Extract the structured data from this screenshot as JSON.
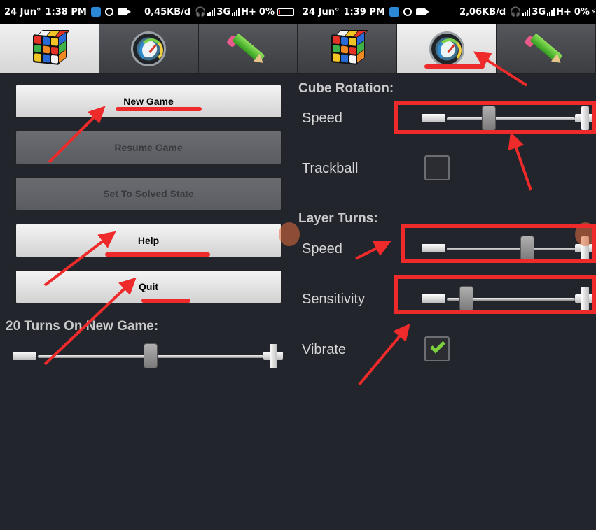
{
  "status_left": {
    "date": "24 Jun°",
    "time": "1:38 PM",
    "network": "0,45KB/d",
    "net_type": "3G",
    "signal2": "H+",
    "battery": "0%"
  },
  "status_right": {
    "date": "24 Jun°",
    "time": "1:39 PM",
    "network": "2,06KB/d",
    "net_type": "3G",
    "signal2": "H+",
    "battery": "0%"
  },
  "tabs": [
    {
      "icon": "rubiks-cube-icon",
      "active": true
    },
    {
      "icon": "speedometer-icon",
      "active": false
    },
    {
      "icon": "pencil-icon",
      "active": false
    },
    {
      "icon": "rubiks-cube-icon",
      "active": false
    },
    {
      "icon": "speedometer-icon",
      "active": true
    },
    {
      "icon": "pencil-icon",
      "active": false
    }
  ],
  "menu": {
    "new_game": "New Game",
    "resume_game": "Resume Game",
    "set_solved": "Set To Solved State",
    "help": "Help",
    "quit": "Quit"
  },
  "turns": {
    "label": "20 Turns On New Game:",
    "value": 0.5
  },
  "settings": {
    "cube_rotation_title": "Cube Rotation:",
    "cube_speed_label": "Speed",
    "cube_speed_value": 0.3,
    "trackball_label": "Trackball",
    "trackball_checked": false,
    "layer_turns_title": "Layer Turns:",
    "layer_speed_label": "Speed",
    "layer_speed_value": 0.65,
    "sensitivity_label": "Sensitivity",
    "sensitivity_value": 0.1,
    "vibrate_label": "Vibrate",
    "vibrate_checked": true
  },
  "colors": {
    "annotation": "#ee2a2a",
    "background": "#23252d",
    "check": "#7ecf3c"
  }
}
